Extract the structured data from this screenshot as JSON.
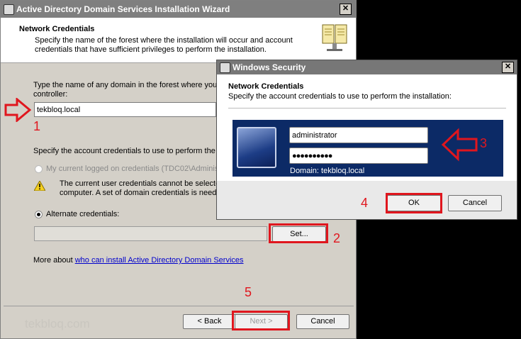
{
  "wizard": {
    "title": "Active Directory Domain Services Installation Wizard",
    "header_title": "Network Credentials",
    "header_desc": "Specify the name of the forest where the installation will occur and account credentials that have sufficient privileges to perform the installation.",
    "domain_prompt": "Type the name of any domain in the forest where you p",
    "domain_prompt_2": "controller:",
    "domain_value": "tekbloq.local",
    "creds_prompt": "Specify the account credentials to use to perform the in",
    "radio_current": "My current logged on credentials (TDC02\\Administ",
    "warning_line1": "The current user credentials cannot be selecte",
    "warning_line2": "computer. A set of domain credentials is neede",
    "radio_alternate": "Alternate credentials:",
    "set_button": "Set...",
    "more_about": "More about",
    "more_link": "who can install Active Directory Domain Services",
    "back_button": "< Back",
    "next_button": "Next >",
    "cancel_button": "Cancel",
    "watermark": "tekbloq.com"
  },
  "security": {
    "title": "Windows Security",
    "heading": "Network Credentials",
    "desc": "Specify the account credentials to use to perform the installation:",
    "username": "administrator",
    "password": "●●●●●●●●●●",
    "domain": "Domain: tekbloq.local",
    "ok_button": "OK",
    "cancel_button": "Cancel"
  },
  "annotations": {
    "n1": "1",
    "n2": "2",
    "n3": "3",
    "n4": "4",
    "n5": "5",
    "color": "#e0161e"
  }
}
